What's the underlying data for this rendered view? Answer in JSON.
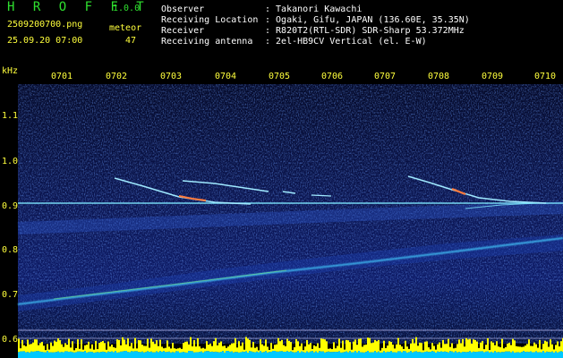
{
  "header": {
    "app_name": "H R O F F T",
    "version": "1.0.0",
    "filename": "2509200700.png",
    "datetime": "25.09.20 07:00",
    "meteor_label": "meteor",
    "meteor_count": "47",
    "observer_key": "Observer",
    "observer_val": ": Takanori Kawachi",
    "location_key": "Receiving Location",
    "location_val": ": Ogaki, Gifu, JAPAN (136.60E, 35.35N)",
    "receiver_key": "Receiver",
    "receiver_val": ": R820T2(RTL-SDR) SDR-Sharp 53.372MHz",
    "antenna_key": "Receiving antenna",
    "antenna_val": ": 2el-HB9CV Vertical (el. E-W)"
  },
  "axes": {
    "y_unit": "kHz",
    "y_ticks": [
      "1.1",
      "1.0",
      "0.9",
      "0.8",
      "0.7",
      "0.6"
    ],
    "x_ticks": [
      "0701",
      "0702",
      "0703",
      "0704",
      "0705",
      "0706",
      "0707",
      "0708",
      "0709",
      "0710"
    ]
  },
  "colors": {
    "background": "#000000",
    "label_yellow": "#ffff3c",
    "title_green": "#2fe02f",
    "signal_cyan": "#44ccff",
    "carrier_cyan": "#7fe8ff",
    "meteor_orange": "#ff7a3c",
    "baseline_yellow": "#ffff00",
    "baseline_cyan": "#00c8ff"
  }
}
